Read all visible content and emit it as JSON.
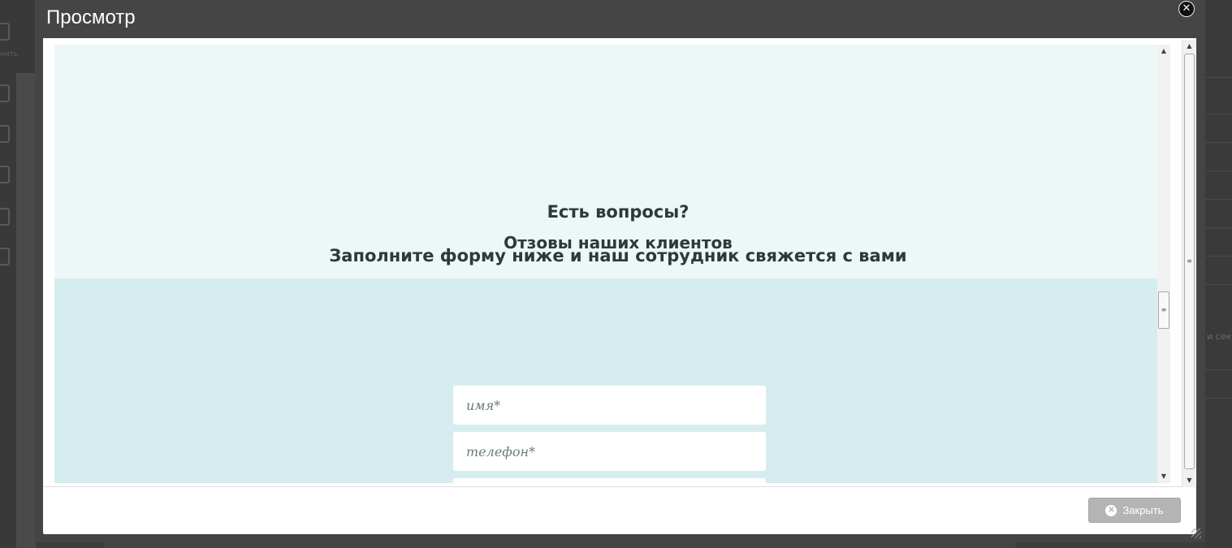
{
  "dialog": {
    "title": "Просмотр",
    "close_icon": "close-icon",
    "close_glyph": "✕"
  },
  "background": {
    "sidebar_label": "нить",
    "right_text": "и секц"
  },
  "preview": {
    "heading_questions": "Есть вопросы?",
    "heading_reviews": "Отзовы наших клиентов",
    "heading_fill": "Заполните форму ниже и наш сотрудник свяжется с вами",
    "form": {
      "name_placeholder": "имя*",
      "phone_placeholder": "телефон*"
    }
  },
  "footer": {
    "close_label": "Закрыть",
    "close_icon": "x-circle-icon",
    "close_icon_glyph": "✕"
  },
  "scrollbars": {
    "up_glyph": "▲",
    "down_glyph": "▼",
    "thumb_glyph": "≡"
  },
  "colors": {
    "section_light": "#eef7f8",
    "section_form": "#d6edf0",
    "heading_text": "#2b3a3a",
    "dialog_frame": "#454545",
    "footer_button": "#b4b4b4"
  }
}
